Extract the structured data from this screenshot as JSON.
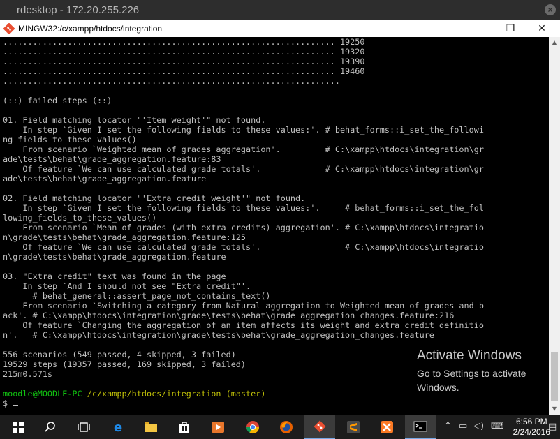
{
  "rdp": {
    "title": "rdesktop - 172.20.255.226"
  },
  "window": {
    "title": "MINGW32:/c/xampp/htdocs/integration",
    "minimize": "—",
    "maximize": "❐",
    "close": "✕"
  },
  "terminal": {
    "lines": [
      "................................................................... 19250",
      "................................................................... 19320",
      "................................................................... 19390",
      "................................................................... 19460",
      ".................................................................... ",
      "",
      "(::) failed steps (::)",
      "",
      "01. Field matching locator \"'Item weight'\" not found.",
      "    In step `Given I set the following fields to these values:'. # behat_forms::i_set_the_followi",
      "ng_fields_to_these_values()",
      "    From scenario `Weighted mean of grades aggregation'.         # C:\\xampp\\htdocs\\integration\\gr",
      "ade\\tests\\behat\\grade_aggregation.feature:83",
      "    Of feature `We can use calculated grade totals'.             # C:\\xampp\\htdocs\\integration\\gr",
      "ade\\tests\\behat\\grade_aggregation.feature",
      "",
      "02. Field matching locator \"'Extra credit weight'\" not found.",
      "    In step `Given I set the following fields to these values:'.     # behat_forms::i_set_the_fol",
      "lowing_fields_to_these_values()",
      "    From scenario `Mean of grades (with extra credits) aggregation'. # C:\\xampp\\htdocs\\integratio",
      "n\\grade\\tests\\behat\\grade_aggregation.feature:125",
      "    Of feature `We can use calculated grade totals'.                 # C:\\xampp\\htdocs\\integratio",
      "n\\grade\\tests\\behat\\grade_aggregation.feature",
      "",
      "03. \"Extra credit\" text was found in the page",
      "    In step `And I should not see \"Extra credit\"'.",
      "      # behat_general::assert_page_not_contains_text()",
      "    From scenario `Switching a category from Natural aggregation to Weighted mean of grades and b",
      "ack'. # C:\\xampp\\htdocs\\integration\\grade\\tests\\behat\\grade_aggregation_changes.feature:216",
      "    Of feature `Changing the aggregation of an item affects its weight and extra credit definitio",
      "n'.   # C:\\xampp\\htdocs\\integration\\grade\\tests\\behat\\grade_aggregation_changes.feature",
      "",
      "556 scenarios (549 passed, 4 skipped, 3 failed)",
      "19529 steps (19357 passed, 169 skipped, 3 failed)",
      "215m0.571s",
      ""
    ],
    "prompt_user": "moodle@MOODLE-PC",
    "prompt_path": "/c/xampp/htdocs/integration",
    "prompt_branch": "(master)",
    "prompt_symbol": "$"
  },
  "watermark": {
    "title": "Activate Windows",
    "subtitle": "Go to Settings to activate Windows."
  },
  "taskbar": {
    "icons": [
      "windows-start-icon",
      "search-icon",
      "task-view-icon",
      "edge-icon",
      "file-explorer-icon",
      "store-icon",
      "media-player-icon",
      "chrome-icon",
      "firefox-icon",
      "git-bash-icon",
      "sublime-icon",
      "xampp-icon",
      "cmd-icon"
    ],
    "time": "6:56 PM",
    "date": "2/24/2016"
  },
  "colors": {
    "terminal_bg": "#000000",
    "terminal_fg": "#c0c0c0",
    "prompt_user": "#11c311",
    "prompt_path": "#c1c108",
    "taskbar_bg": "#1c1c1c"
  }
}
